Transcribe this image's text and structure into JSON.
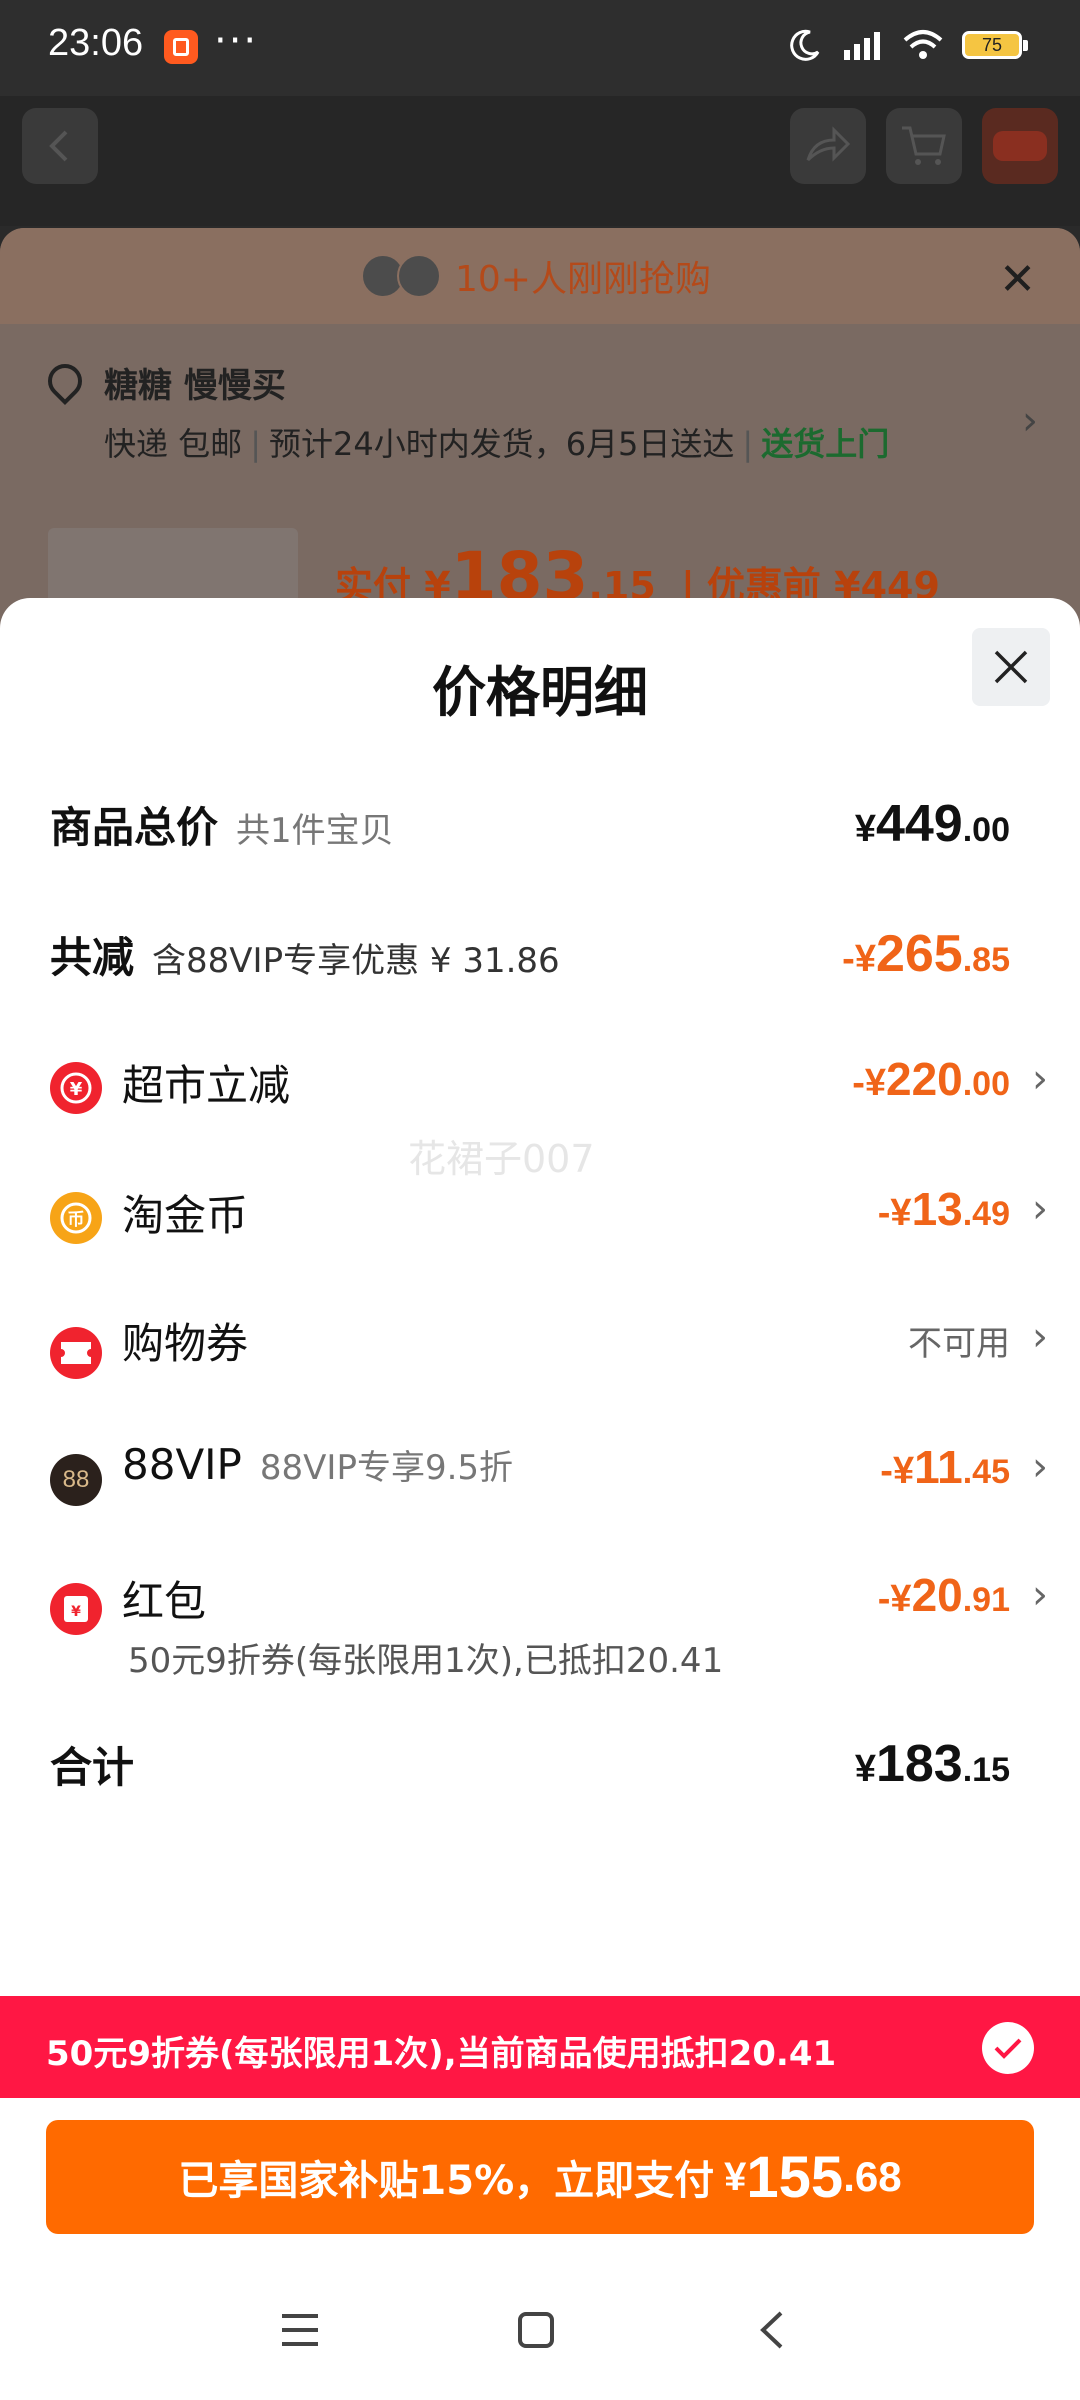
{
  "status_bar": {
    "time": "23:06",
    "dots": "···",
    "battery": "75"
  },
  "background_page": {
    "hot_text": "10+人刚刚抢购",
    "address_name": "糖糖 慢慢买",
    "shipping_parts": [
      "快递 包邮",
      "预计24小时内发货，6月5日送达"
    ],
    "delivery_tag": "送货上门",
    "paid_label": "实付 ¥",
    "paid_int": "183",
    "paid_dec": ".15",
    "original_label": "优惠前 ¥449"
  },
  "sheet": {
    "title": "价格明细",
    "watermark": "花裙子007",
    "total_price": {
      "label": "商品总价",
      "sub": "共1件宝贝",
      "currency": "¥",
      "int": "449",
      "dec": ".00"
    },
    "total_discount": {
      "label": "共减",
      "sub": "含88VIP专享优惠 ¥ 31.86",
      "currency": "-¥",
      "int": "265",
      "dec": ".85"
    },
    "items": [
      {
        "key": "supermarket",
        "label": "超市立减",
        "sub": "",
        "currency": "-¥",
        "int": "220",
        "dec": ".00"
      },
      {
        "key": "coins",
        "label": "淘金币",
        "sub": "",
        "currency": "-¥",
        "int": "13",
        "dec": ".49"
      },
      {
        "key": "voucher",
        "label": "购物券",
        "sub": "",
        "status": "不可用"
      },
      {
        "key": "vip",
        "label": "88VIP",
        "sub": "88VIP专享9.5折",
        "currency": "-¥",
        "int": "11",
        "dec": ".45"
      },
      {
        "key": "redpacket",
        "label": "红包",
        "sub": "",
        "currency": "-¥",
        "int": "20",
        "dec": ".91",
        "note": "50元9折券(每张限用1次),已抵扣20.41"
      }
    ],
    "sum": {
      "label": "合计",
      "currency": "¥",
      "int": "183",
      "dec": ".15"
    },
    "banner": "50元9折券(每张限用1次),当前商品使用抵扣20.41",
    "pay_button": {
      "label": "已享国家补贴15%，立即支付",
      "currency": "¥",
      "int": "155",
      "dec": ".68"
    }
  },
  "colors": {
    "accent_orange": "#ff6a00",
    "discount_orange": "#f06418",
    "banner_red": "#ff1744",
    "green": "#1c6a2f"
  },
  "icons": [
    "back-arrow-icon",
    "share-icon",
    "cart-icon",
    "more-icon",
    "close-icon",
    "location-pin-icon",
    "chevron-right-icon",
    "yuan-discount-icon",
    "coin-icon",
    "ticket-icon",
    "vip88-icon",
    "red-envelope-icon",
    "check-icon",
    "menu-icon",
    "home-square-icon",
    "back-icon"
  ]
}
